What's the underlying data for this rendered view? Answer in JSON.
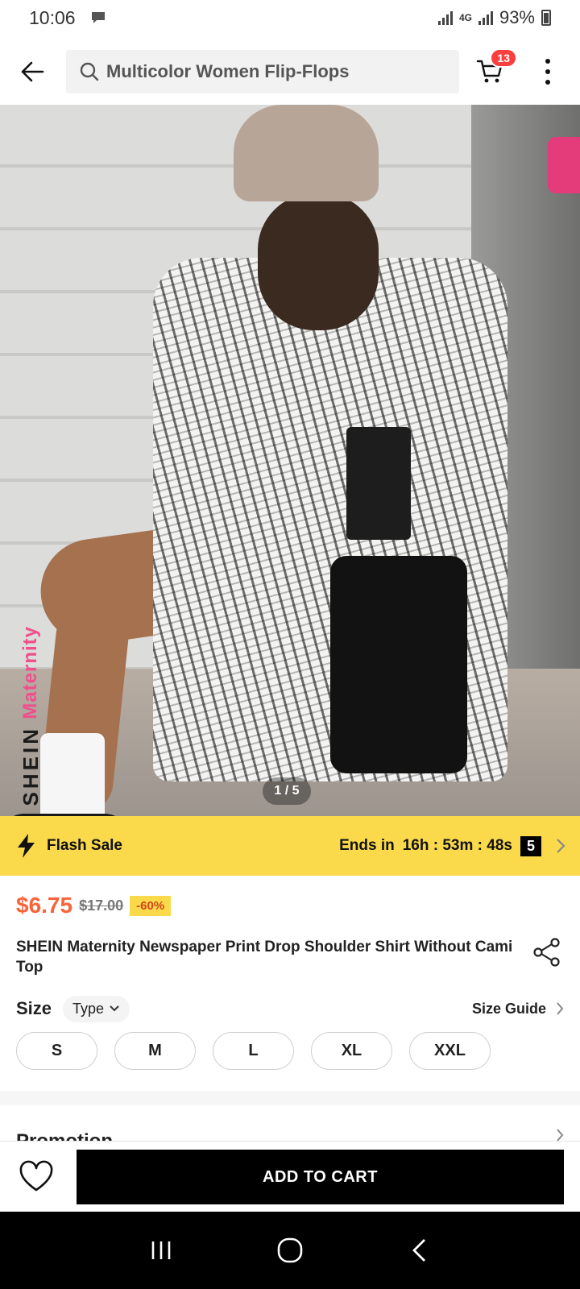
{
  "status_bar": {
    "time": "10:06",
    "network": "4G",
    "battery": "93%"
  },
  "header": {
    "search_text": "Multicolor Women Flip-Flops",
    "cart_count": "13"
  },
  "gallery": {
    "pager": "1 / 5",
    "watermark_brand": "SHEIN",
    "watermark_sub": "Maternity"
  },
  "flash_sale": {
    "label": "Flash Sale",
    "ends_label": "Ends in",
    "countdown": "16h : 53m : 48s",
    "count": "5"
  },
  "product": {
    "price": "$6.75",
    "original_price": "$17.00",
    "discount": "-60%",
    "title": "SHEIN Maternity Newspaper Print Drop Shoulder Shirt Without Cami Top"
  },
  "size": {
    "label": "Size",
    "type_label": "Type",
    "guide_label": "Size Guide",
    "options": [
      "S",
      "M",
      "L",
      "XL",
      "XXL"
    ]
  },
  "promotion": {
    "title": "Promotion"
  },
  "bottom_bar": {
    "add_to_cart": "ADD TO CART"
  },
  "colors": {
    "accent_price": "#fa6338",
    "flash_yellow": "#fad94b",
    "badge_red": "#fa3f3f"
  }
}
